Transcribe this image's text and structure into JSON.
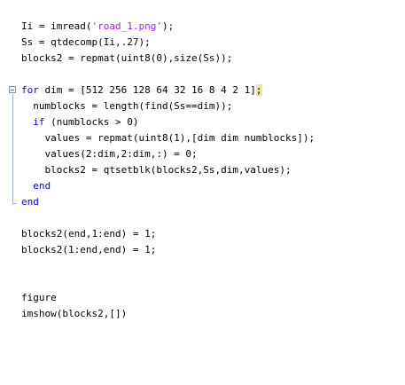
{
  "code": {
    "l1_a": "Ii = imread(",
    "l1_b": "'road_1.png'",
    "l1_c": ");",
    "l2": "Ss = qtdecomp(Ii,.27);",
    "l3": "blocks2 = repmat(uint8(0),size(Ss));",
    "l4_kw": "for",
    "l4_a": " dim = [512 256 128 64 32 16 8 4 2 1]",
    "l4_b": ";",
    "l5": "  numblocks = length(find(Ss==dim));",
    "l6_indent": "  ",
    "l6_kw": "if",
    "l6_a": " (numblocks > 0)",
    "l7": "    values = repmat(uint8(1),[dim dim numblocks]);",
    "l8": "    values(2:dim,2:dim,:) = 0;",
    "l9": "    blocks2 = qtsetblk(blocks2,Ss,dim,values);",
    "l10_indent": "  ",
    "l10_kw": "end",
    "l11_kw": "end",
    "l12": "blocks2(end,1:end) = 1;",
    "l13": "blocks2(1:end,end) = 1;",
    "l14": "figure",
    "l15": "imshow(blocks2,[])"
  },
  "colors": {
    "keyword": "#0000ff",
    "string": "#a020f0",
    "bracket_highlight": "#f0e68c"
  }
}
